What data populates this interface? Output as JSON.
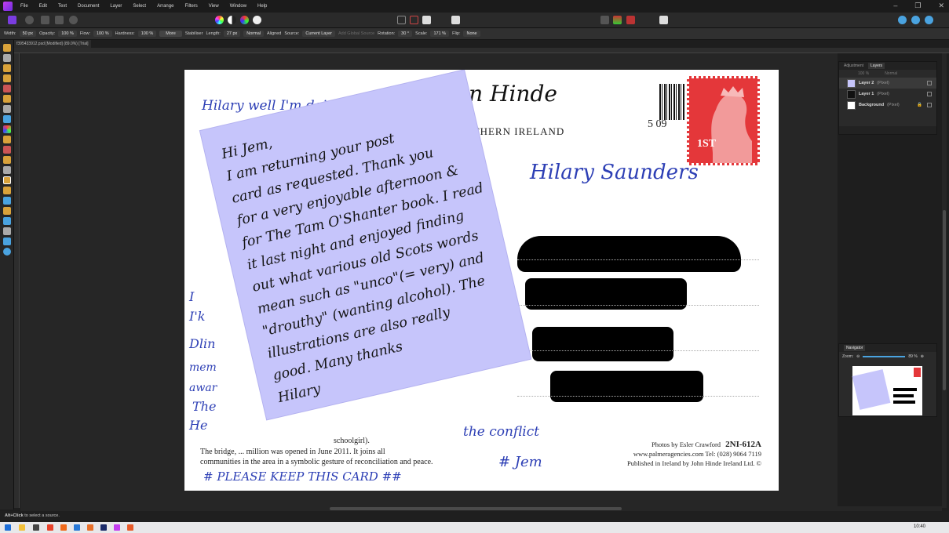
{
  "menubar": {
    "items": [
      "File",
      "Edit",
      "Text",
      "Document",
      "Layer",
      "Select",
      "Arrange",
      "Filters",
      "View",
      "Window",
      "Help"
    ]
  },
  "context_toolbar": {
    "width_label": "Width:",
    "width_value": "50 px",
    "opacity_label": "Opacity:",
    "opacity_value": "100 %",
    "flow_label": "Flow:",
    "flow_value": "100 %",
    "hardness_label": "Hardness:",
    "hardness_value": "100 %",
    "more_label": "More",
    "stabiliser_label": "Stabiliser",
    "length_label": "Length:",
    "length_value": "27 px",
    "blend_value": "Normal",
    "aligned_label": "Aligned",
    "source_label": "Source:",
    "source_value": "Current Layer",
    "add_global_source_label": "Add Global Source",
    "rotation_label": "Rotation:",
    "rotation_value": "30 °",
    "scale_label": "Scale:",
    "scale_value": "171 %",
    "flip_label": "Flip:",
    "flip_value": "None"
  },
  "document_tab": {
    "title": "f395433912.psd [Modified] (89.0%) [Trial]"
  },
  "postcard": {
    "brand": "John Hinde",
    "brand_sub": "NORTHERN IRELAND",
    "stamp_number": "5 09",
    "stamp_class": "1ST",
    "address_handwriting": "Hilary Saunders",
    "top_handwriting": "Hilary well I'm doing",
    "side_handwriting": [
      "I",
      "I'k",
      "Dlin",
      "mem",
      "awar",
      "The",
      "He"
    ],
    "bottom_handwriting": "# PLEASE KEEP THIS CARD ##",
    "signoff_handwriting": [
      "the conflict",
      "# Jem"
    ],
    "caption_fragment": "schoolgirl).",
    "caption_line1": "The bridge, ... million was opened in June 2011. It joins all",
    "caption_line2": "communities in the area in a symbolic gesture of reconciliation and peace.",
    "credit_line1": "Photos by Esler Crawford",
    "credit_code": "2NI-612A",
    "credit_line2": "www.palmeragencies.com  Tel: (028) 9064 7119",
    "credit_line3": "Published in Ireland by John Hinde Ireland Ltd. ©"
  },
  "note": {
    "lines": [
      "Hi Jem,",
      "   I am returning your post",
      "card as requested. Thank you",
      "for a very enjoyable afternoon &",
      "for The Tam O'Shanter book. I read",
      "it last night and enjoyed finding",
      "out what various old Scots words",
      "mean such as \"unco\"(= very) and",
      "\"drouthy\" (wanting alcohol). The",
      "illustrations are also really",
      "good.      Many thanks",
      "                   Hilary"
    ]
  },
  "layers_panel": {
    "tabs": [
      "Adjustment",
      "Layers"
    ],
    "opacity_value": "100 %",
    "blend_value": "Normal",
    "layers": [
      {
        "name": "Layer 2",
        "type": "(Pixel)"
      },
      {
        "name": "Layer 1",
        "type": "(Pixel)"
      },
      {
        "name": "Background",
        "type": "(Pixel)"
      }
    ]
  },
  "navigator_panel": {
    "title": "Navigator",
    "zoom_label": "Zoom:",
    "zoom_value": "89 %"
  },
  "statusbar": {
    "hint_bold": "Alt+Click",
    "hint_rest": " to select a source."
  },
  "taskbar": {
    "clock": "10:40"
  },
  "colors": {
    "note": "#c6c5fb",
    "stamp": "#e4373a",
    "ink": "#2d3fb5",
    "app_bg": "#1e1e1e"
  }
}
